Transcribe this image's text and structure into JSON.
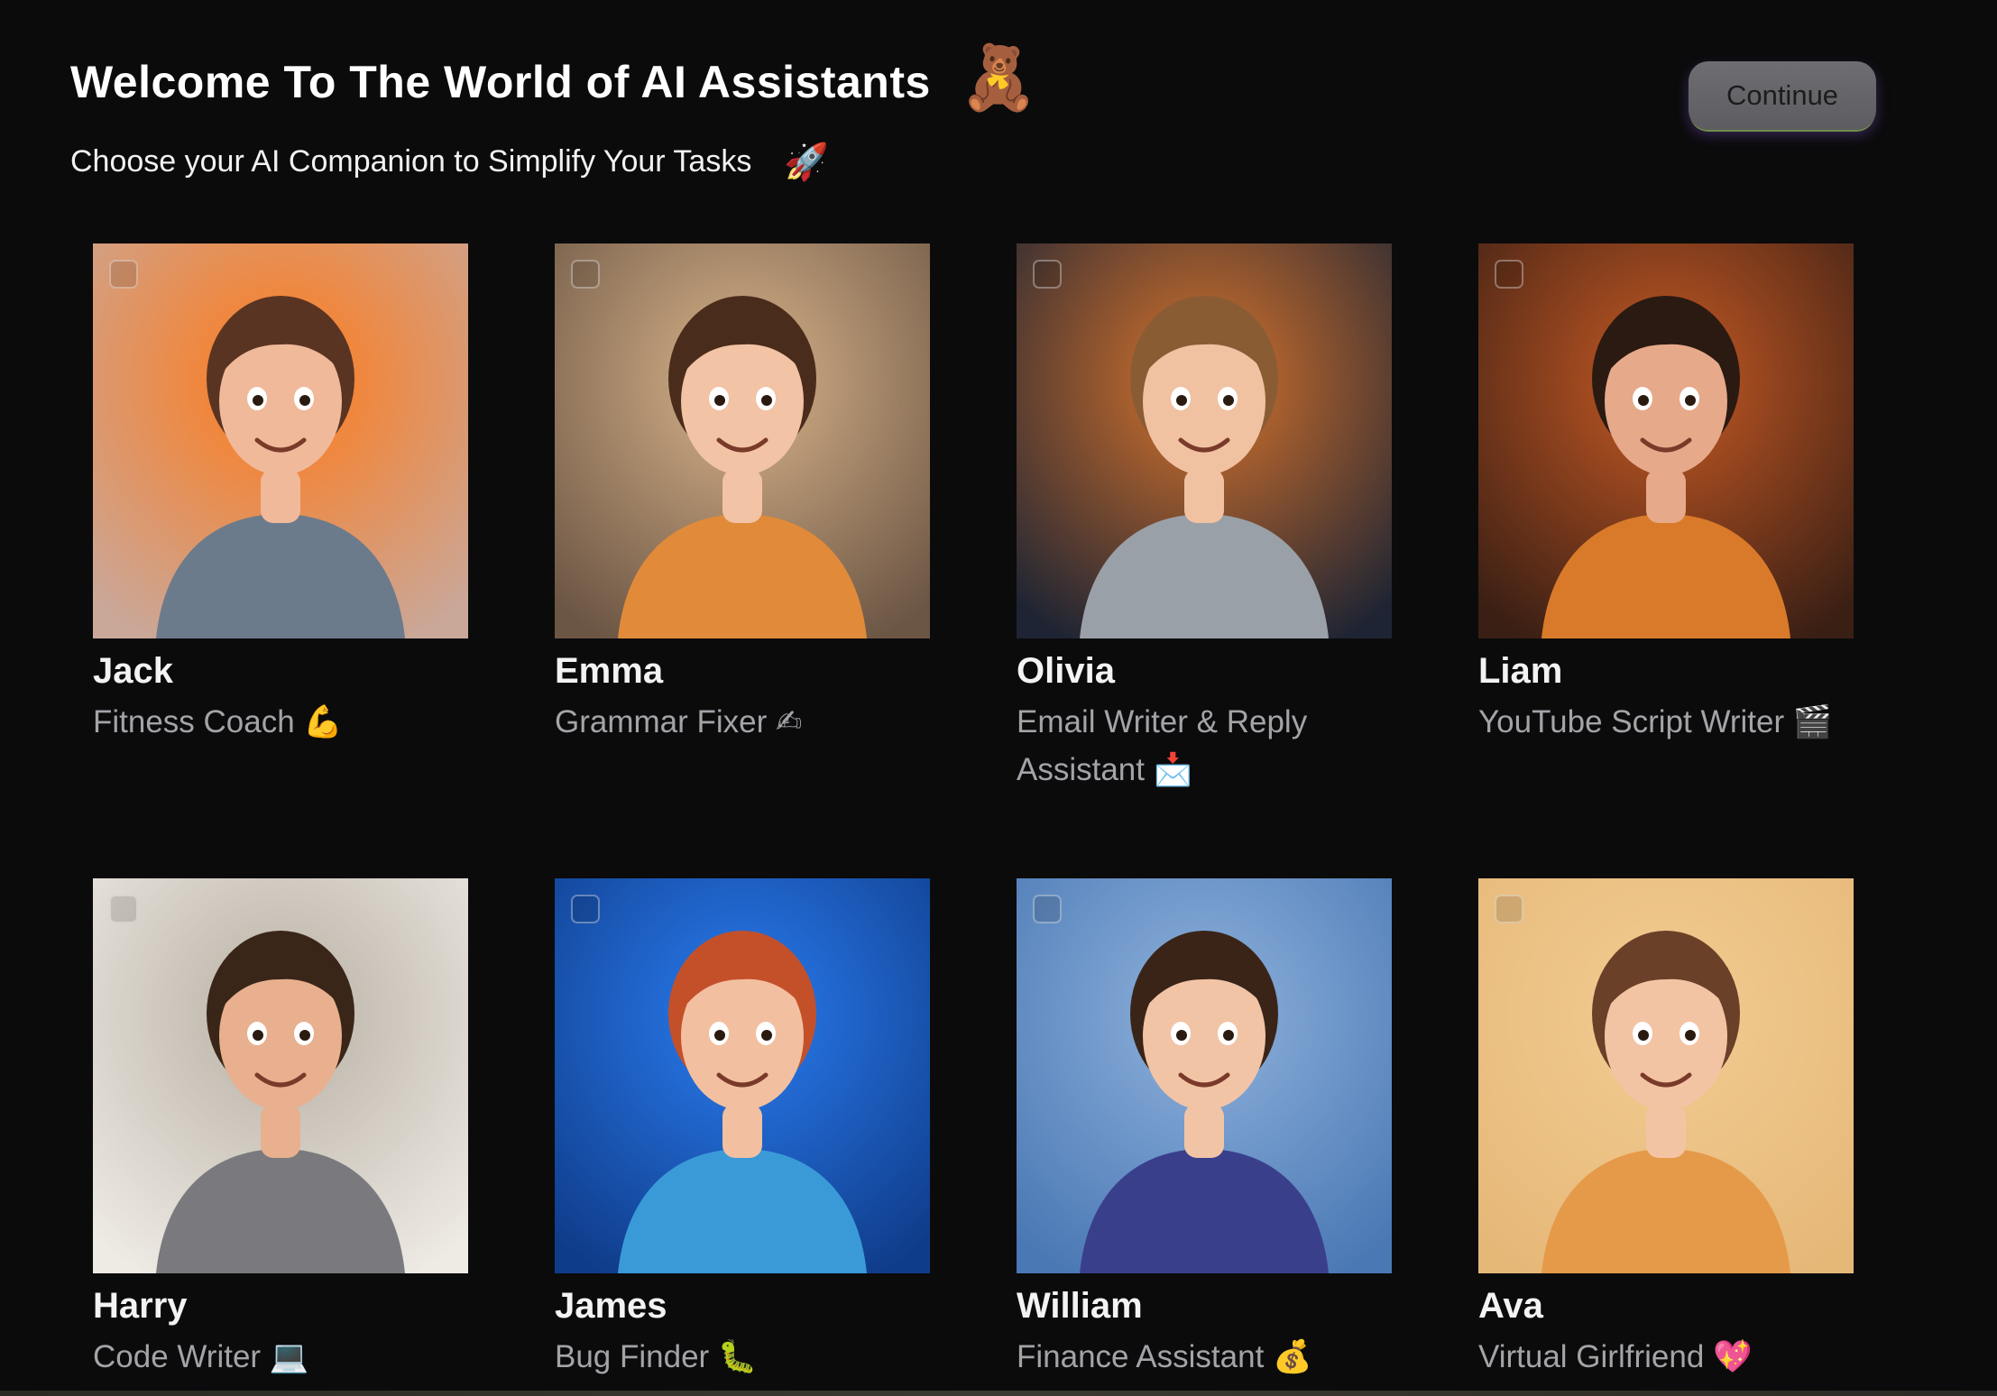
{
  "header": {
    "title": "Welcome To The World of AI Assistants",
    "title_emoji": "🧸",
    "subtitle": "Choose your AI Companion to Simplify Your Tasks",
    "subtitle_emoji": "🚀"
  },
  "continue_button": {
    "label": "Continue"
  },
  "assistants": [
    {
      "name": "Jack",
      "role": "Fitness Coach 💪",
      "bg": "#c9a89a",
      "accent": "#ff7a1a",
      "skin": "#f0b99a",
      "hair": "#5a3422",
      "shirt": "#6c7b8c"
    },
    {
      "name": "Emma",
      "role": "Grammar Fixer ✍",
      "bg": "#6b5544",
      "accent": "#d9b48a",
      "skin": "#f2c3a4",
      "hair": "#4a2c1c",
      "shirt": "#e08a3a"
    },
    {
      "name": "Olivia",
      "role": "Email Writer & Reply Assistant 📩",
      "bg": "#1e2433",
      "accent": "#d9742c",
      "skin": "#f1c2a2",
      "hair": "#8a5c34",
      "shirt": "#9aa0a8"
    },
    {
      "name": "Liam",
      "role": "YouTube Script Writer 🎬",
      "bg": "#3a1f14",
      "accent": "#c85a24",
      "skin": "#e6a98a",
      "hair": "#2a1a12",
      "shirt": "#d97a2a"
    },
    {
      "name": "Harry",
      "role": "Code Writer 💻",
      "bg": "#eeeae4",
      "accent": "#b8b0a4",
      "skin": "#e8b08e",
      "hair": "#3a2618",
      "shirt": "#7a7a7e"
    },
    {
      "name": "James",
      "role": "Bug Finder 🐛",
      "bg": "#0f3c8a",
      "accent": "#2a7cf0",
      "skin": "#f2c0a0",
      "hair": "#c4502a",
      "shirt": "#3a9ad8"
    },
    {
      "name": "William",
      "role": "Finance Assistant 💰",
      "bg": "#4a78b4",
      "accent": "#8fb2dc",
      "skin": "#f2c4a6",
      "hair": "#3a2418",
      "shirt": "#3a3f8c"
    },
    {
      "name": "Ava",
      "role": "Virtual Girlfriend 💖",
      "bg": "#e6b878",
      "accent": "#f2cc92",
      "skin": "#f3c4a4",
      "hair": "#6a4028",
      "shirt": "#e59a4a"
    }
  ]
}
